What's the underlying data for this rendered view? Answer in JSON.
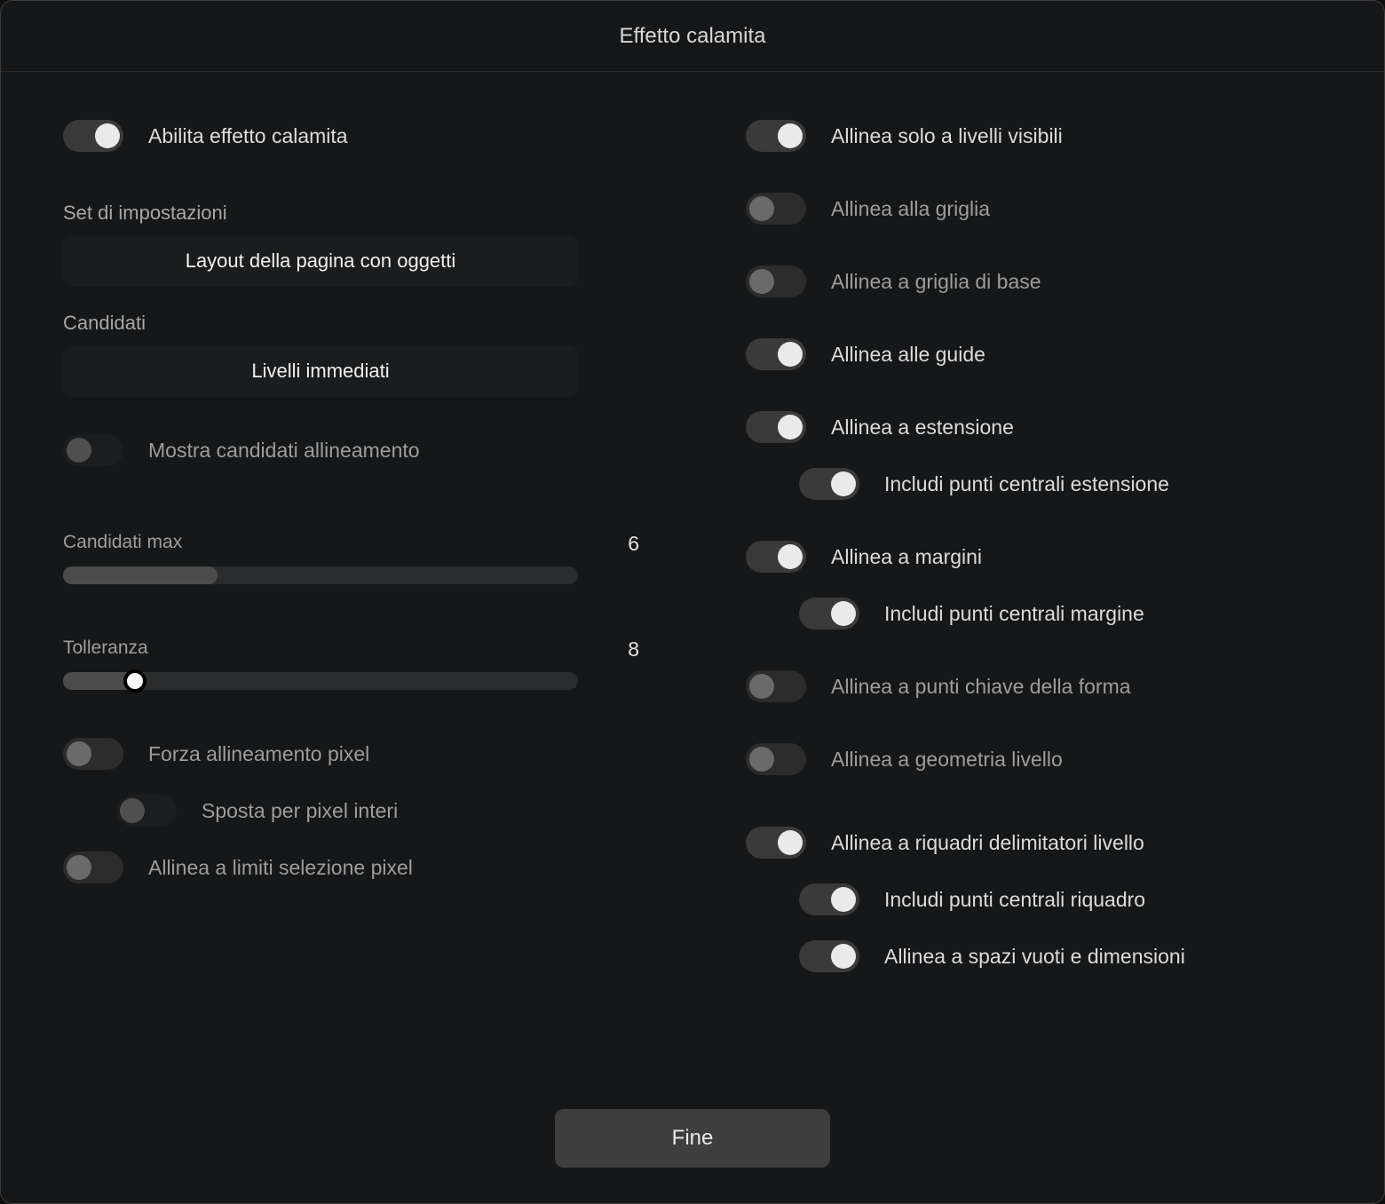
{
  "title": "Effetto calamita",
  "footer": {
    "done_label": "Fine"
  },
  "left": {
    "enable_label": "Abilita effetto calamita",
    "preset_section_label": "Set di impostazioni",
    "preset_value": "Layout della pagina con oggetti",
    "candidates_section_label": "Candidati",
    "candidates_value": "Livelli immediati",
    "show_candidates_label": "Mostra candidati allineamento",
    "max_candidates_label": "Candidati max",
    "max_candidates_value": "6",
    "max_candidates_fill_pct": 30,
    "tolerance_label": "Tolleranza",
    "tolerance_value": "8",
    "tolerance_fill_pct": 14,
    "force_pixel_align_label": "Forza allineamento pixel",
    "move_whole_pixels_label": "Sposta per pixel interi",
    "snap_pixel_selection_label": "Allinea a limiti selezione pixel"
  },
  "right": {
    "visible_only_label": "Allinea solo a livelli visibili",
    "snap_grid_label": "Allinea alla griglia",
    "snap_baseline_grid_label": "Allinea a griglia di base",
    "snap_guides_label": "Allinea alle guide",
    "snap_spread_label": "Allinea a estensione",
    "spread_midpoints_label": "Includi punti centrali estensione",
    "snap_margins_label": "Allinea a margini",
    "margin_midpoints_label": "Includi punti centrali margine",
    "snap_shape_keypoints_label": "Allinea a punti chiave della forma",
    "snap_layer_geometry_label": "Allinea a geometria livello",
    "snap_bounding_boxes_label": "Allinea a riquadri delimitatori livello",
    "bbox_midpoints_label": "Includi punti centrali riquadro",
    "gaps_sizes_label": "Allinea a spazi vuoti e dimensioni"
  }
}
